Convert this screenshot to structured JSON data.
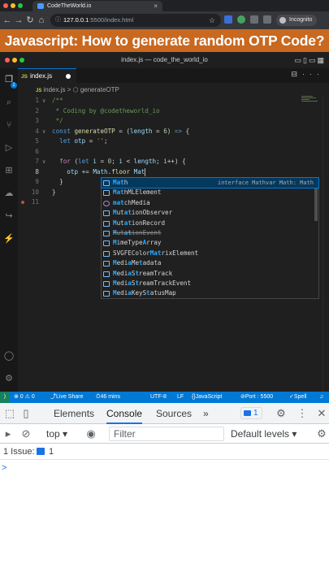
{
  "browser": {
    "tab_title": "CodeTheWorld.io",
    "tab_close": "×",
    "nav_back": "←",
    "nav_forward": "→",
    "nav_reload": "↻",
    "nav_home": "⌂",
    "url_host": "127.0.0.1",
    "url_rest": ":5500/index.html",
    "incognito_label": "Incognito"
  },
  "banner": {
    "title": "Javascript: How to generate random OTP Code?"
  },
  "vscode": {
    "window_title": "index.js — code_the_world_io",
    "tab_label": "index.js",
    "tab_js_badge": "JS",
    "breadcrumb_file": "index.js",
    "breadcrumb_sep": ">",
    "breadcrumb_symbol": "generateOTP",
    "explorer_badge": "1",
    "code_lines": [
      {
        "n": "1",
        "text": "/**"
      },
      {
        "n": "2",
        "text": " * Coding by @codetheworld_io"
      },
      {
        "n": "3",
        "text": " */"
      },
      {
        "n": "4",
        "text": "const generateOTP = (length = 6) => {"
      },
      {
        "n": "5",
        "text": "  let otp = '';"
      },
      {
        "n": "6",
        "text": ""
      },
      {
        "n": "7",
        "text": "  for (let i = 0; i < length; i++) {"
      },
      {
        "n": "8",
        "text": "    otp += Math.floor Mat"
      },
      {
        "n": "9",
        "text": "  }"
      },
      {
        "n": "10",
        "text": "}"
      },
      {
        "n": "11",
        "text": ""
      }
    ],
    "suggestions": [
      {
        "label": "Math",
        "detail": "interface Mathvar Math: Math",
        "kind": "var",
        "selected": true
      },
      {
        "label": "MathMLElement",
        "kind": "var"
      },
      {
        "label": "matchMedia",
        "kind": "fn"
      },
      {
        "label": "MutationObserver",
        "kind": "var"
      },
      {
        "label": "MutationRecord",
        "kind": "var"
      },
      {
        "label": "MutationEvent",
        "kind": "var",
        "deprecated": true
      },
      {
        "label": "MimeTypeArray",
        "kind": "var"
      },
      {
        "label": "SVGFEColorMatrixElement",
        "kind": "var"
      },
      {
        "label": "MediaMetadata",
        "kind": "var"
      },
      {
        "label": "MediaStreamTrack",
        "kind": "var"
      },
      {
        "label": "MediaStreamTrackEvent",
        "kind": "var"
      },
      {
        "label": "MediaKeyStatusMap",
        "kind": "var"
      }
    ],
    "status": {
      "remote": "⟩",
      "problems": "⊗ 0 ⚠ 0",
      "live_share": "Live Share",
      "time": "46 mins",
      "encoding": "UTF-8",
      "eol": "LF",
      "language": "JavaScript",
      "port": "Port : 5500",
      "spell": "Spell"
    }
  },
  "devtools": {
    "tabs": [
      "Elements",
      "Console",
      "Sources"
    ],
    "active_tab": "Console",
    "more": "»",
    "message_count": "1",
    "context": "top",
    "filter_placeholder": "Filter",
    "levels": "Default levels",
    "issues_label": "1 Issue:",
    "issues_count": "1",
    "prompt": ">"
  },
  "colors": {
    "banner": "#c9681f",
    "editor_bg": "#1f1f1f",
    "statusbar": "#0078d4",
    "accent": "#1a73e8"
  }
}
